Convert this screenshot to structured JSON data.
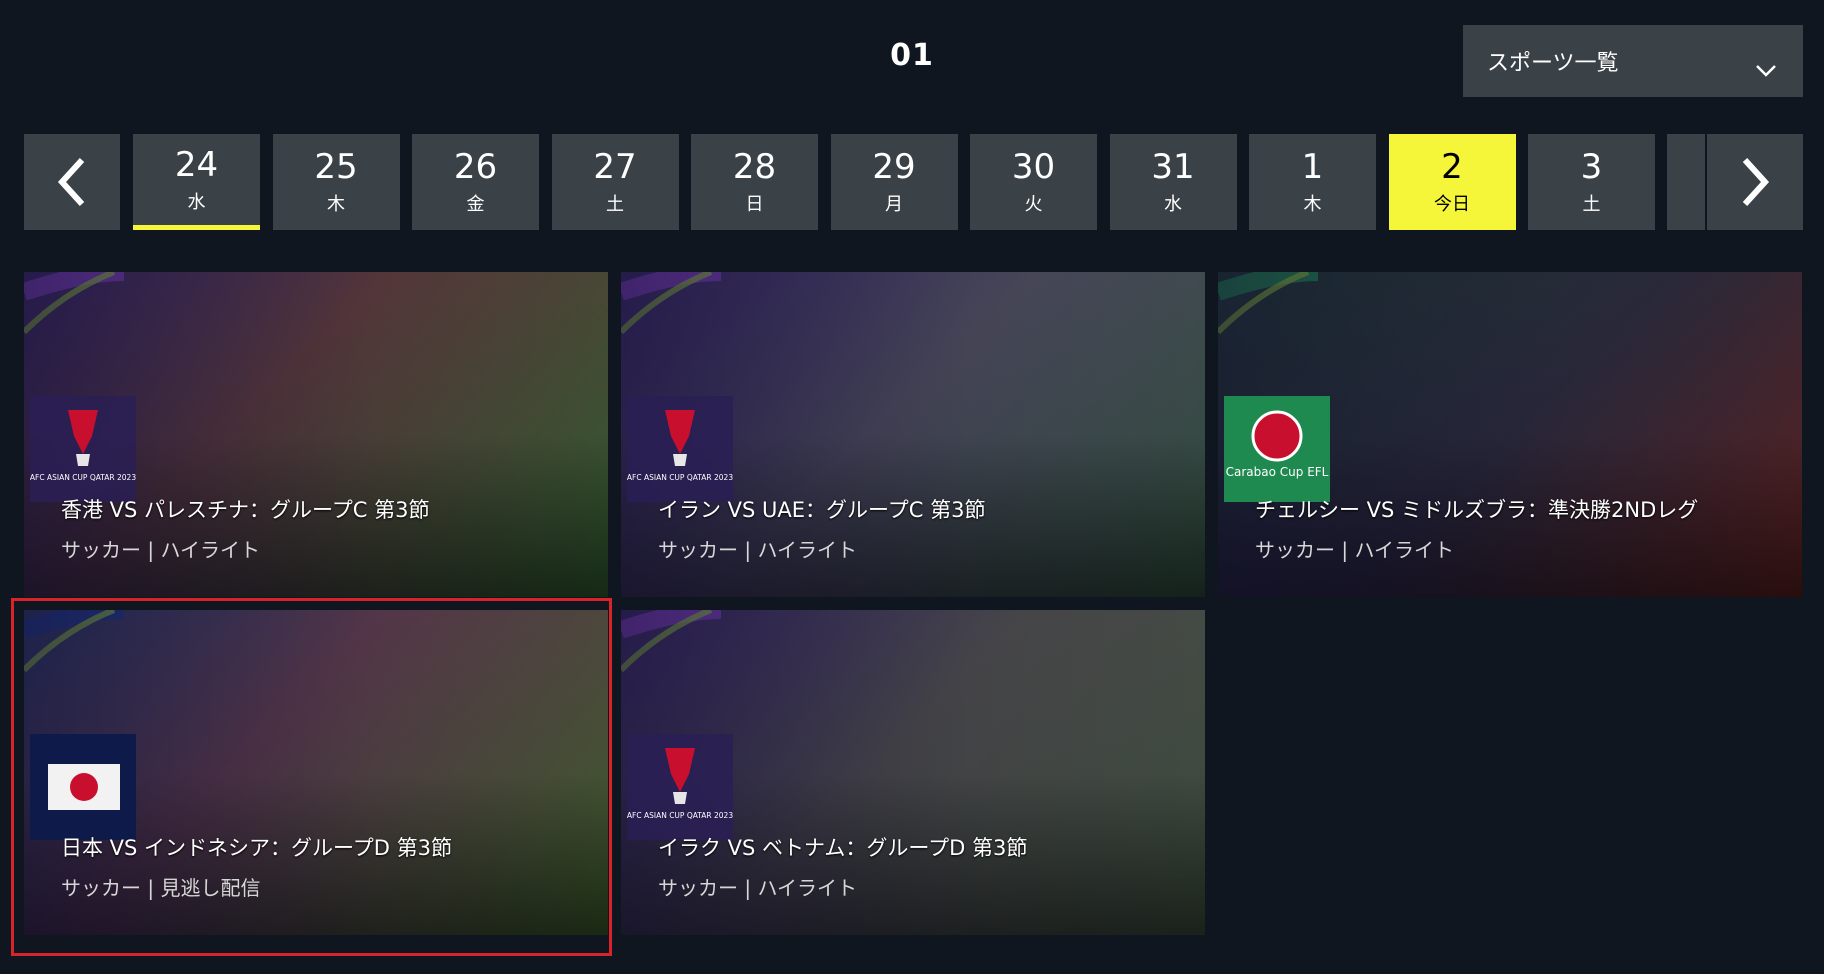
{
  "header": {
    "month": "01"
  },
  "sport_select": {
    "label": "スポーツ一覧"
  },
  "dates": [
    {
      "num": "24",
      "wd": "水",
      "state": "selected"
    },
    {
      "num": "25",
      "wd": "木"
    },
    {
      "num": "26",
      "wd": "金"
    },
    {
      "num": "27",
      "wd": "土"
    },
    {
      "num": "28",
      "wd": "日"
    },
    {
      "num": "29",
      "wd": "月"
    },
    {
      "num": "30",
      "wd": "火"
    },
    {
      "num": "31",
      "wd": "水"
    },
    {
      "num": "1",
      "wd": "木"
    },
    {
      "num": "2",
      "wd": "今日",
      "state": "today"
    },
    {
      "num": "3",
      "wd": "土"
    }
  ],
  "cards": [
    {
      "title": "香港 VS パレスチナ：グループC 第3節",
      "meta": "サッカー | ハイライト",
      "badge": "afc-asian-cup-logo",
      "badge_text": "AFC ASIAN CUP QATAR 2023",
      "accent": "#7a3fb8"
    },
    {
      "title": "イラン VS UAE：グループC 第3節",
      "meta": "サッカー | ハイライト",
      "badge": "afc-asian-cup-logo",
      "badge_text": "AFC ASIAN CUP QATAR 2023",
      "accent": "#7a3fb8"
    },
    {
      "title": "チェルシー VS ミドルズブラ：準決勝2NDレグ",
      "meta": "サッカー | ハイライト",
      "badge": "carabao-cup-logo",
      "badge_text": "Carabao Cup EFL",
      "accent": "#1f8a4f"
    },
    {
      "title": "日本 VS インドネシア：グループD 第3節",
      "meta": "サッカー | 見逃し配信",
      "badge": "japan-flag",
      "accent": "#1e3a8a"
    },
    {
      "title": "イラク VS ベトナム：グループD 第3節",
      "meta": "サッカー | ハイライト",
      "badge": "afc-asian-cup-logo",
      "badge_text": "AFC ASIAN CUP QATAR 2023",
      "accent": "#7a3fb8"
    }
  ],
  "colors": {
    "background": "#0f1620",
    "tile": "#3a4147",
    "accent_yellow": "#f5f53a",
    "focus_red": "#d9232a"
  }
}
